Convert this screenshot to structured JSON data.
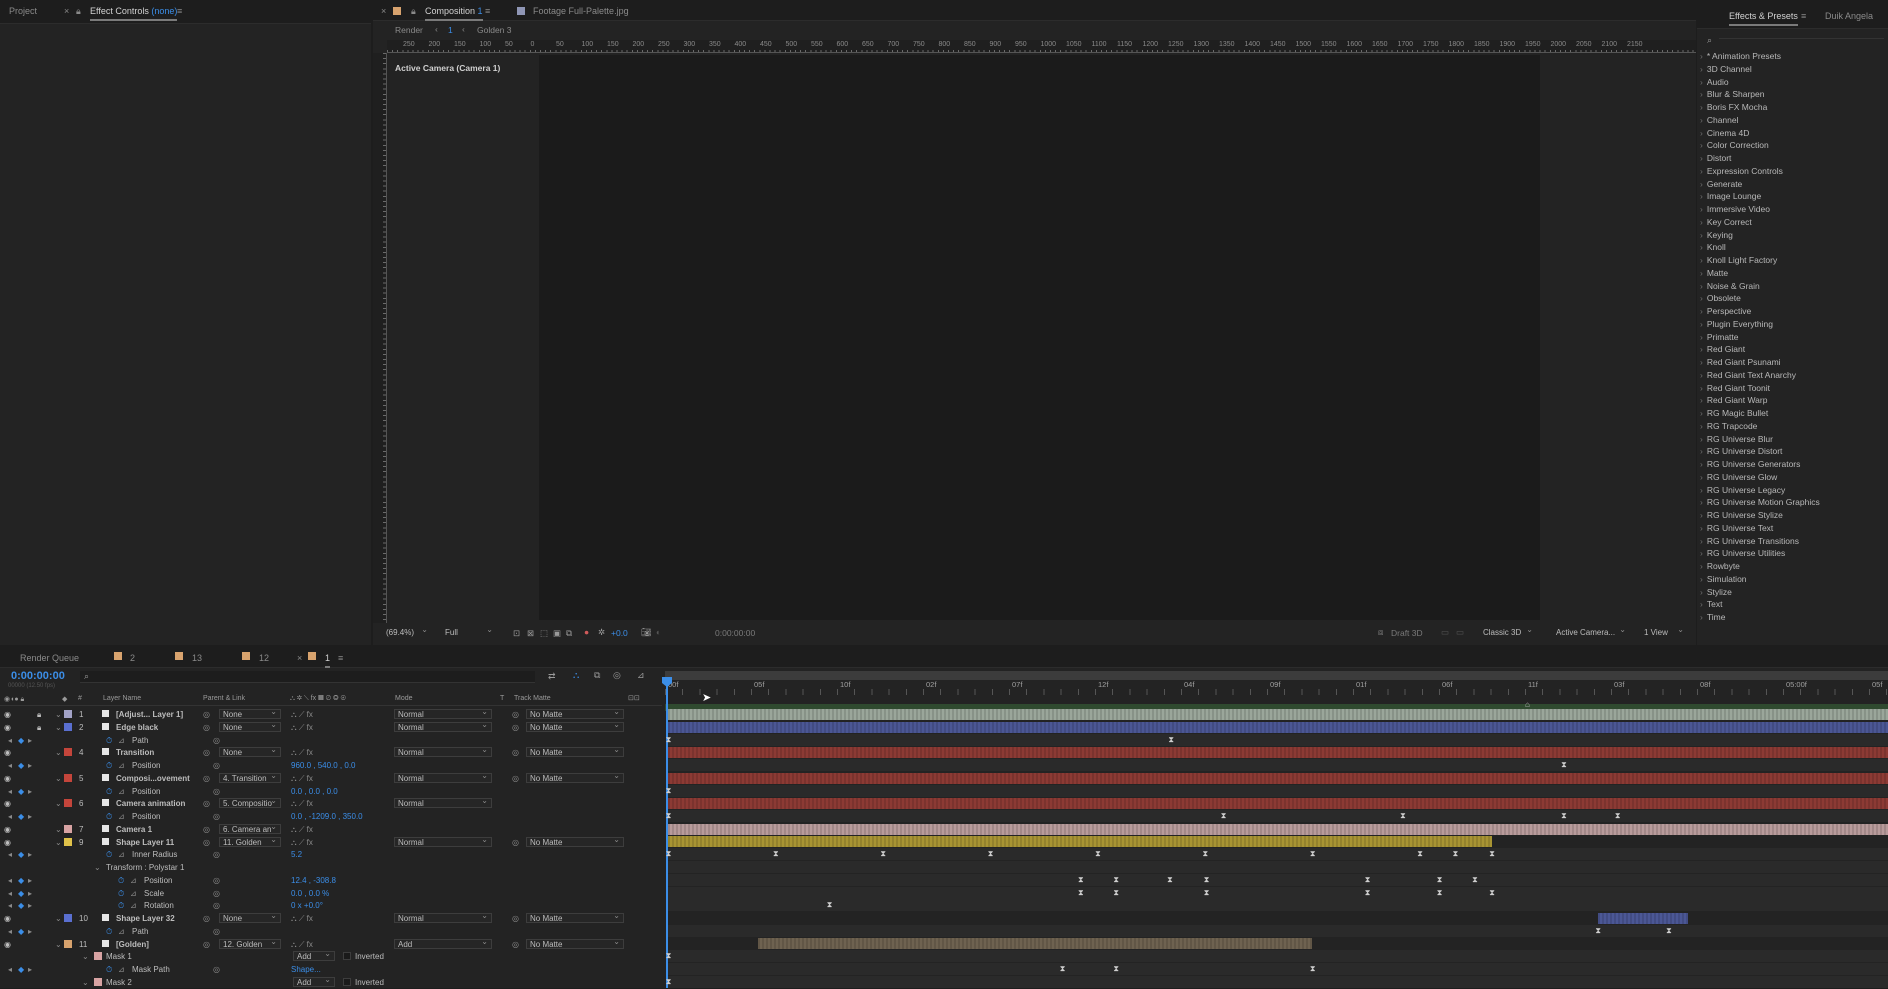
{
  "left_panel": {
    "tabs": [
      {
        "label": "Project"
      },
      {
        "label": "Effect Controls",
        "suffix": "(none)"
      }
    ]
  },
  "viewer": {
    "tabs": [
      {
        "label": "Composition",
        "num": "1"
      },
      {
        "label": "Footage",
        "name": "Full-Palette.jpg"
      }
    ],
    "breadcrumb": {
      "render": "Render",
      "item1": "1",
      "item2": "Golden 3"
    },
    "camera_label": "Active Camera (Camera 1)",
    "ruler_ticks": [
      "250",
      "200",
      "150",
      "100",
      "50",
      "0",
      "50",
      "100",
      "150",
      "200",
      "250",
      "300",
      "350",
      "400",
      "450",
      "500",
      "550",
      "600",
      "650",
      "700",
      "750",
      "800",
      "850",
      "900",
      "950",
      "1000",
      "1050",
      "1100",
      "1150",
      "1200",
      "1250",
      "1300",
      "1350",
      "1400",
      "1450",
      "1500",
      "1550",
      "1600",
      "1650",
      "1700",
      "1750",
      "1800",
      "1850",
      "1900",
      "1950",
      "2000",
      "2050",
      "2100",
      "2150"
    ],
    "footer": {
      "zoom": "(69.4%)",
      "resolution": "Full",
      "exposure": "+0.0",
      "timecode": "0:00:00:00",
      "draft": "Draft 3D",
      "renderer": "Classic 3D",
      "camera": "Active Camera...",
      "views": "1 View"
    },
    "colors": {
      "comp_bg": "#1b1b1b",
      "panel_bg": "#232323"
    }
  },
  "effects_panel": {
    "tabs": [
      {
        "label": "Effects & Presets"
      },
      {
        "label": "Duik Angela"
      }
    ],
    "items": [
      "* Animation Presets",
      "3D Channel",
      "Audio",
      "Blur & Sharpen",
      "Boris FX Mocha",
      "Channel",
      "Cinema 4D",
      "Color Correction",
      "Distort",
      "Expression Controls",
      "Generate",
      "Image Lounge",
      "Immersive Video",
      "Key Correct",
      "Keying",
      "Knoll",
      "Knoll Light Factory",
      "Matte",
      "Noise & Grain",
      "Obsolete",
      "Perspective",
      "Plugin Everything",
      "Primatte",
      "Red Giant",
      "Red Giant Psunami",
      "Red Giant Text Anarchy",
      "Red Giant Toonit",
      "Red Giant Warp",
      "RG Magic Bullet",
      "RG Trapcode",
      "RG Universe Blur",
      "RG Universe Distort",
      "RG Universe Generators",
      "RG Universe Glow",
      "RG Universe Legacy",
      "RG Universe Motion Graphics",
      "RG Universe Stylize",
      "RG Universe Text",
      "RG Universe Transitions",
      "RG Universe Utilities",
      "Rowbyte",
      "Simulation",
      "Stylize",
      "Text",
      "Time"
    ]
  },
  "timeline": {
    "tabs": [
      {
        "label": "Render Queue",
        "color": ""
      },
      {
        "label": "2",
        "color": "#d8a36e"
      },
      {
        "label": "13",
        "color": "#d8a36e"
      },
      {
        "label": "12",
        "color": "#d8a36e"
      },
      {
        "label": "1",
        "color": "#d8a36e"
      }
    ],
    "timecode": "0:00:00:00",
    "fps_info": "00000 (12.50 fps)",
    "headers": {
      "num": "#",
      "layer_name": "Layer Name",
      "parent": "Parent & Link",
      "mode": "Mode",
      "t": "T",
      "track_matte": "Track Matte"
    },
    "ruler": [
      "00f",
      "05f",
      "10f",
      "02f",
      "07f",
      "12f",
      "04f",
      "09f",
      "01f",
      "06f",
      "11f",
      "03f",
      "08f",
      "05:00f",
      "05f"
    ],
    "rows": [
      {
        "type": "layer",
        "num": "1",
        "name": "[Adjust... Layer 1]",
        "color": "#a3a3c7",
        "parent": "None",
        "mode": "Normal",
        "matte": "No Matte",
        "bar_color": "#9aa69a",
        "bar_start": 0,
        "bar_end": 1,
        "keys": []
      },
      {
        "type": "layer",
        "num": "2",
        "name": "Edge black",
        "color": "#5a6fd0",
        "parent": "None",
        "mode": "Normal",
        "matte": "No Matte",
        "bar_color": "#4b5795",
        "bar_start": 0,
        "bar_end": 1,
        "keys": []
      },
      {
        "type": "prop",
        "name": "Path",
        "value": "",
        "indent": 3,
        "keys": [
          0,
          0.412
        ]
      },
      {
        "type": "layer",
        "num": "4",
        "name": "Transition",
        "color": "#c4453b",
        "parent": "None",
        "mode": "Normal",
        "matte": "No Matte",
        "bar_color": "#8c3a34",
        "bar_start": 0,
        "bar_end": 1,
        "keys": []
      },
      {
        "type": "prop",
        "name": "Position",
        "value": "960.0 , 540.0 , 0.0",
        "indent": 3,
        "keys": [
          0.734
        ]
      },
      {
        "type": "layer",
        "num": "5",
        "name": "Composi...ovement",
        "color": "#c4453b",
        "parent": "4. Transition",
        "mode": "Normal",
        "matte": "No Matte",
        "bar_color": "#8c3a34",
        "bar_start": 0,
        "bar_end": 1,
        "keys": []
      },
      {
        "type": "prop",
        "name": "Position",
        "value": "0.0 , 0.0 , 0.0",
        "indent": 3,
        "keys": [
          0
        ]
      },
      {
        "type": "layer",
        "num": "6",
        "name": "Camera animation",
        "color": "#c4453b",
        "parent": "5. Compositio",
        "mode": "Normal",
        "matte": "",
        "bar_color": "#8c3a34",
        "bar_start": 0,
        "bar_end": 1,
        "keys": []
      },
      {
        "type": "prop",
        "name": "Position",
        "value": "0.0 , -1209.0 , 350.0",
        "indent": 3,
        "keys": [
          0,
          0.455,
          0.602,
          0.734,
          0.778
        ]
      },
      {
        "type": "layer",
        "num": "7",
        "name": "Camera 1",
        "color": "#d8a3a3",
        "parent": "6. Camera an",
        "mode": "",
        "matte": "",
        "bar_color": "#b89b9b",
        "bar_start": 0,
        "bar_end": 1,
        "keys": []
      },
      {
        "type": "layer",
        "num": "9",
        "name": "Shape Layer 11",
        "color": "#e0c24a",
        "parent": "11. Golden",
        "mode": "Normal",
        "matte": "No Matte",
        "bar_color": "#a89433",
        "bar_start": 0,
        "bar_end": 0.675,
        "keys": []
      },
      {
        "type": "prop",
        "name": "Inner Radius",
        "value": "5.2",
        "indent": 3,
        "keys": [
          0,
          0.088,
          0.176,
          0.264,
          0.352,
          0.44,
          0.528,
          0.616,
          0.645,
          0.675
        ]
      },
      {
        "type": "group",
        "name": "Transform : Polystar 1",
        "indent": 2
      },
      {
        "type": "prop",
        "name": "Position",
        "value": "12.4 , -308.8",
        "indent": 4,
        "keys": [
          0.338,
          0.367,
          0.411,
          0.441,
          0.573,
          0.632,
          0.661
        ]
      },
      {
        "type": "prop",
        "name": "Scale",
        "value": "0.0 , 0.0 %",
        "indent": 4,
        "keys": [
          0.338,
          0.367,
          0.441,
          0.573,
          0.632,
          0.675
        ]
      },
      {
        "type": "prop",
        "name": "Rotation",
        "value": "0 x +0.0°",
        "indent": 4,
        "keys": [
          0.132
        ]
      },
      {
        "type": "layer",
        "num": "10",
        "name": "Shape Layer 32",
        "color": "#5a6fd0",
        "parent": "None",
        "mode": "Normal",
        "matte": "No Matte",
        "bar_color": "#4b5795",
        "bar_start": 0.762,
        "bar_end": 0.836,
        "keys": []
      },
      {
        "type": "prop",
        "name": "Path",
        "value": "",
        "indent": 3,
        "keys": [
          0.762,
          0.82
        ]
      },
      {
        "type": "layer",
        "num": "11",
        "name": "[Golden]",
        "color": "#d8a36e",
        "parent": "12. Golden",
        "mode": "Add",
        "matte": "No Matte",
        "bar_color": "#6e6250",
        "bar_start": 0.074,
        "bar_end": 0.528,
        "keys": []
      },
      {
        "type": "mask",
        "name": "Mask 1",
        "mode": "Add",
        "inverted": "Inverted",
        "color": "#d8a3a3",
        "keys": [
          0
        ]
      },
      {
        "type": "prop",
        "name": "Mask Path",
        "value": "Shape...",
        "indent": 3,
        "keys": [
          0.323,
          0.367,
          0.528
        ]
      },
      {
        "type": "mask",
        "name": "Mask 2",
        "mode": "Add",
        "inverted": "Inverted",
        "color": "#d8a3a3",
        "keys": [
          0
        ]
      }
    ]
  }
}
